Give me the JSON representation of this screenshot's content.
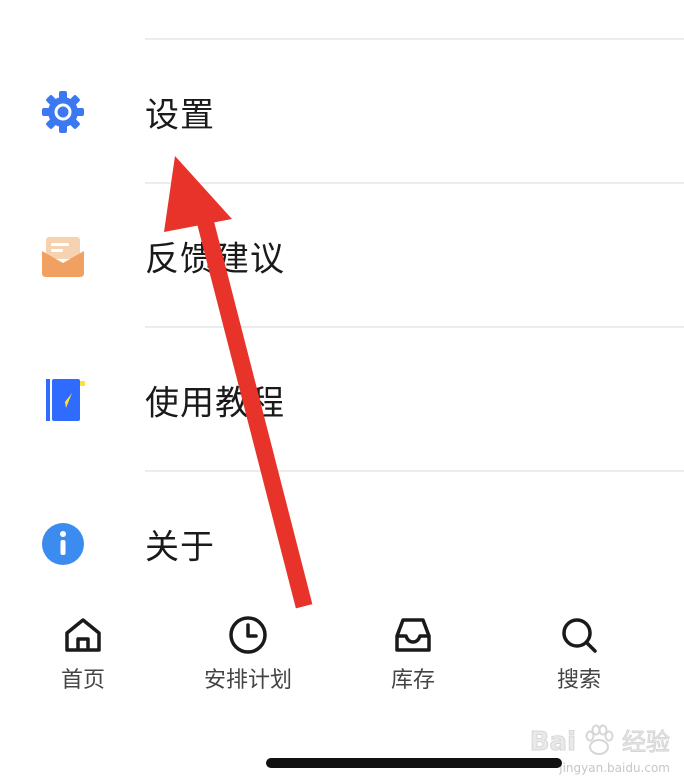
{
  "menu": {
    "items": [
      {
        "label": "设置",
        "icon": "gear-icon"
      },
      {
        "label": "反馈建议",
        "icon": "mail-icon"
      },
      {
        "label": "使用教程",
        "icon": "tutorial-book-icon"
      },
      {
        "label": "关于",
        "icon": "info-icon"
      }
    ]
  },
  "tabbar": {
    "items": [
      {
        "label": "首页",
        "icon": "home-icon"
      },
      {
        "label": "安排计划",
        "icon": "clock-icon"
      },
      {
        "label": "库存",
        "icon": "inbox-icon"
      },
      {
        "label": "搜索",
        "icon": "search-icon"
      }
    ]
  },
  "watermark": {
    "brand": "Bai",
    "text": "经验",
    "domain": "jingyan.baidu.com"
  },
  "colors": {
    "gear": "#3c78f0",
    "mail": "#f0a060",
    "book": "#2f6bff",
    "info": "#3c8cf0",
    "arrow": "#e8332a"
  }
}
